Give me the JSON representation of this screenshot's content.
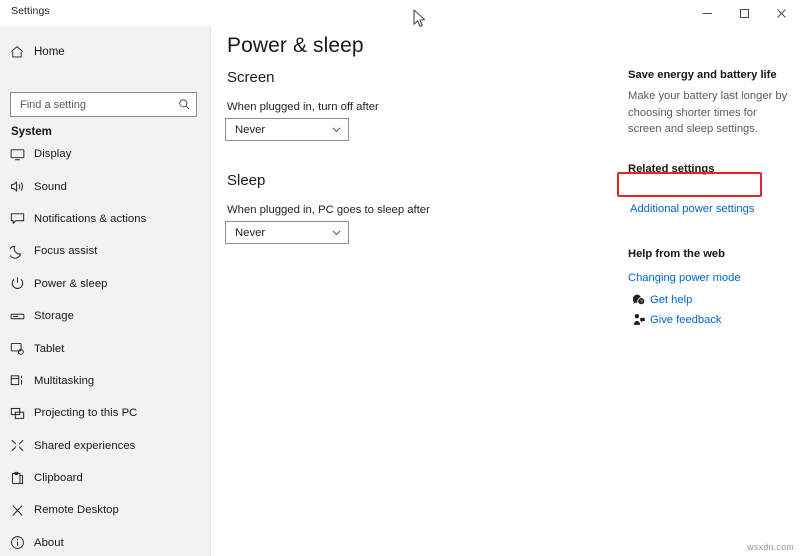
{
  "window": {
    "title": "Settings",
    "controls": [
      {
        "name": "minimize",
        "glyph": "minimize-icon"
      },
      {
        "name": "maximize",
        "glyph": "maximize-icon"
      },
      {
        "name": "close",
        "glyph": "close-icon"
      }
    ]
  },
  "sidebar": {
    "home_label": "Home",
    "home_icon": "home-icon",
    "search": {
      "placeholder": "Find a setting",
      "value": "",
      "icon": "search-icon"
    },
    "group_title": "System",
    "items": [
      {
        "label": "Display",
        "icon": "monitor-icon",
        "selected": false
      },
      {
        "label": "Sound",
        "icon": "speaker-icon",
        "selected": false
      },
      {
        "label": "Notifications & actions",
        "icon": "notification-icon",
        "selected": false
      },
      {
        "label": "Focus assist",
        "icon": "moon-icon",
        "selected": false
      },
      {
        "label": "Power & sleep",
        "icon": "power-icon",
        "selected": false
      },
      {
        "label": "Storage",
        "icon": "drive-icon",
        "selected": false
      },
      {
        "label": "Tablet",
        "icon": "tablet-icon",
        "selected": false
      },
      {
        "label": "Multitasking",
        "icon": "multitask-icon",
        "selected": false
      },
      {
        "label": "Projecting to this PC",
        "icon": "project-icon",
        "selected": false
      },
      {
        "label": "Shared experiences",
        "icon": "share-icon",
        "selected": false
      },
      {
        "label": "Clipboard",
        "icon": "clipboard-icon",
        "selected": false
      },
      {
        "label": "Remote Desktop",
        "icon": "remote-desktop-icon",
        "selected": false
      },
      {
        "label": "About",
        "icon": "info-icon",
        "selected": false
      }
    ]
  },
  "main": {
    "page_title": "Power & sleep",
    "screen": {
      "heading": "Screen",
      "field_label": "When plugged in, turn off after",
      "dropdown_value": "Never"
    },
    "sleep": {
      "heading": "Sleep",
      "field_label": "When plugged in, PC goes to sleep after",
      "dropdown_value": "Never"
    }
  },
  "right_pane": {
    "save_energy_heading": "Save energy and battery life",
    "save_energy_body": "Make your battery last longer by choosing shorter times for screen and sleep settings.",
    "related_settings_heading": "Related settings",
    "additional_power_settings_link": "Additional power settings",
    "help_heading": "Help from the web",
    "changing_power_mode_link": "Changing power mode",
    "get_help_link": "Get help",
    "get_help_icon": "question-bubble-icon",
    "give_feedback_link": "Give feedback",
    "give_feedback_icon": "feedback-icon"
  },
  "annotations": {
    "highlight_color": "#e8232a",
    "highlight_target": "Additional power settings"
  },
  "watermark": "wsxdn.com",
  "colors": {
    "sidebar_bg": "#f2f2f2",
    "content_bg": "#ffffff",
    "link": "#0066cc",
    "accent": "#0078d7",
    "text": "#1a1a1a",
    "muted_text": "#5c5c5c"
  }
}
